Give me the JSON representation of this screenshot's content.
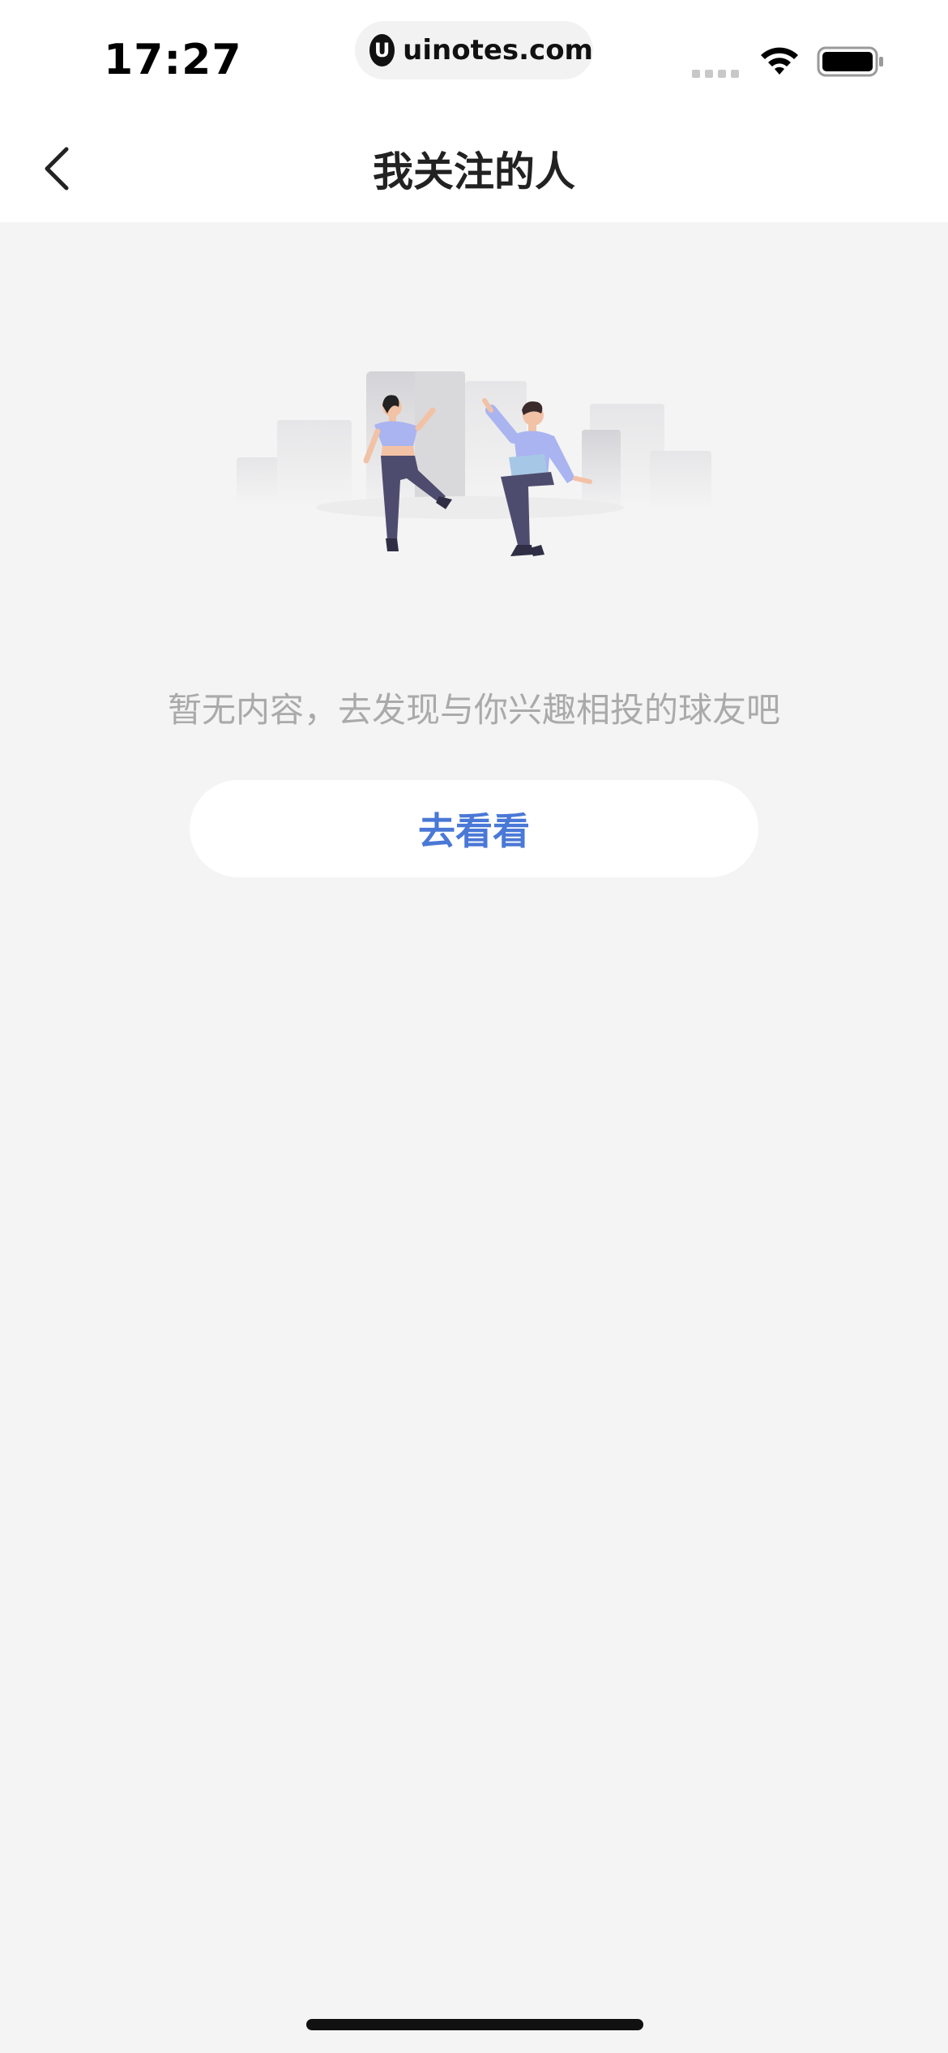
{
  "status_bar": {
    "time": "17:27",
    "url": "uinotes.com",
    "url_logo": "U"
  },
  "nav": {
    "title": "我关注的人",
    "back_icon": "chevron-left-icon"
  },
  "empty_state": {
    "message": "暂无内容，去发现与你兴趣相投的球友吧",
    "button_label": "去看看"
  },
  "colors": {
    "accent": "#4a78d6",
    "background": "#f4f4f4",
    "muted_text": "#aaaaaa"
  }
}
